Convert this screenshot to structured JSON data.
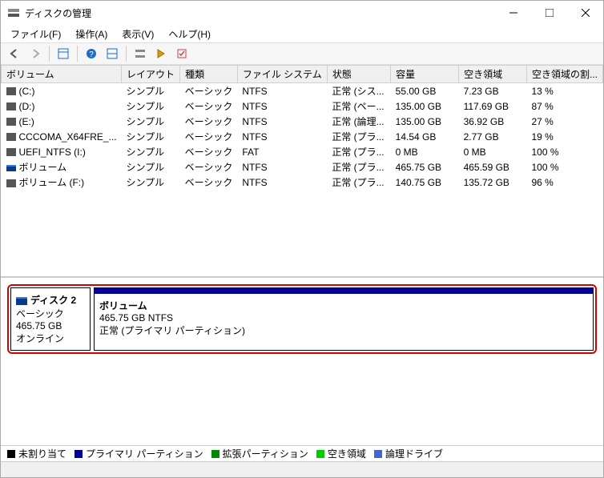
{
  "window": {
    "title": "ディスクの管理"
  },
  "menubar": {
    "file": "ファイル(F)",
    "action": "操作(A)",
    "view": "表示(V)",
    "help": "ヘルプ(H)"
  },
  "columns": {
    "volume": "ボリューム",
    "layout": "レイアウト",
    "type": "種類",
    "filesystem": "ファイル システム",
    "status": "状態",
    "capacity": "容量",
    "free": "空き領域",
    "percent": "空き領域の割..."
  },
  "volumes": [
    {
      "name": "(C:)",
      "layout": "シンプル",
      "type": "ベーシック",
      "fs": "NTFS",
      "status": "正常 (シス...",
      "capacity": "55.00 GB",
      "free": "7.23 GB",
      "percent": "13 %"
    },
    {
      "name": "(D:)",
      "layout": "シンプル",
      "type": "ベーシック",
      "fs": "NTFS",
      "status": "正常 (ペー...",
      "capacity": "135.00 GB",
      "free": "117.69 GB",
      "percent": "87 %"
    },
    {
      "name": "(E:)",
      "layout": "シンプル",
      "type": "ベーシック",
      "fs": "NTFS",
      "status": "正常 (論理...",
      "capacity": "135.00 GB",
      "free": "36.92 GB",
      "percent": "27 %"
    },
    {
      "name": "CCCOMA_X64FRE_...",
      "layout": "シンプル",
      "type": "ベーシック",
      "fs": "NTFS",
      "status": "正常 (プラ...",
      "capacity": "14.54 GB",
      "free": "2.77 GB",
      "percent": "19 %"
    },
    {
      "name": "UEFI_NTFS (I:)",
      "layout": "シンプル",
      "type": "ベーシック",
      "fs": "FAT",
      "status": "正常 (プラ...",
      "capacity": "0 MB",
      "free": "0 MB",
      "percent": "100 %"
    },
    {
      "name": "ボリューム",
      "layout": "シンプル",
      "type": "ベーシック",
      "fs": "NTFS",
      "status": "正常 (プラ...",
      "capacity": "465.75 GB",
      "free": "465.59 GB",
      "percent": "100 %",
      "blue": true
    },
    {
      "name": "ボリューム (F:)",
      "layout": "シンプル",
      "type": "ベーシック",
      "fs": "NTFS",
      "status": "正常 (プラ...",
      "capacity": "140.75 GB",
      "free": "135.72 GB",
      "percent": "96 %"
    }
  ],
  "disk": {
    "label": "ディスク 2",
    "type": "ベーシック",
    "size": "465.75 GB",
    "state": "オンライン",
    "partition": {
      "name": "ボリューム",
      "info": "465.75 GB NTFS",
      "status": "正常 (プライマリ パーティション)"
    }
  },
  "legend": {
    "unalloc": "未割り当て",
    "primary": "プライマリ パーティション",
    "extended": "拡張パーティション",
    "free": "空き領域",
    "logical": "論理ドライブ"
  }
}
